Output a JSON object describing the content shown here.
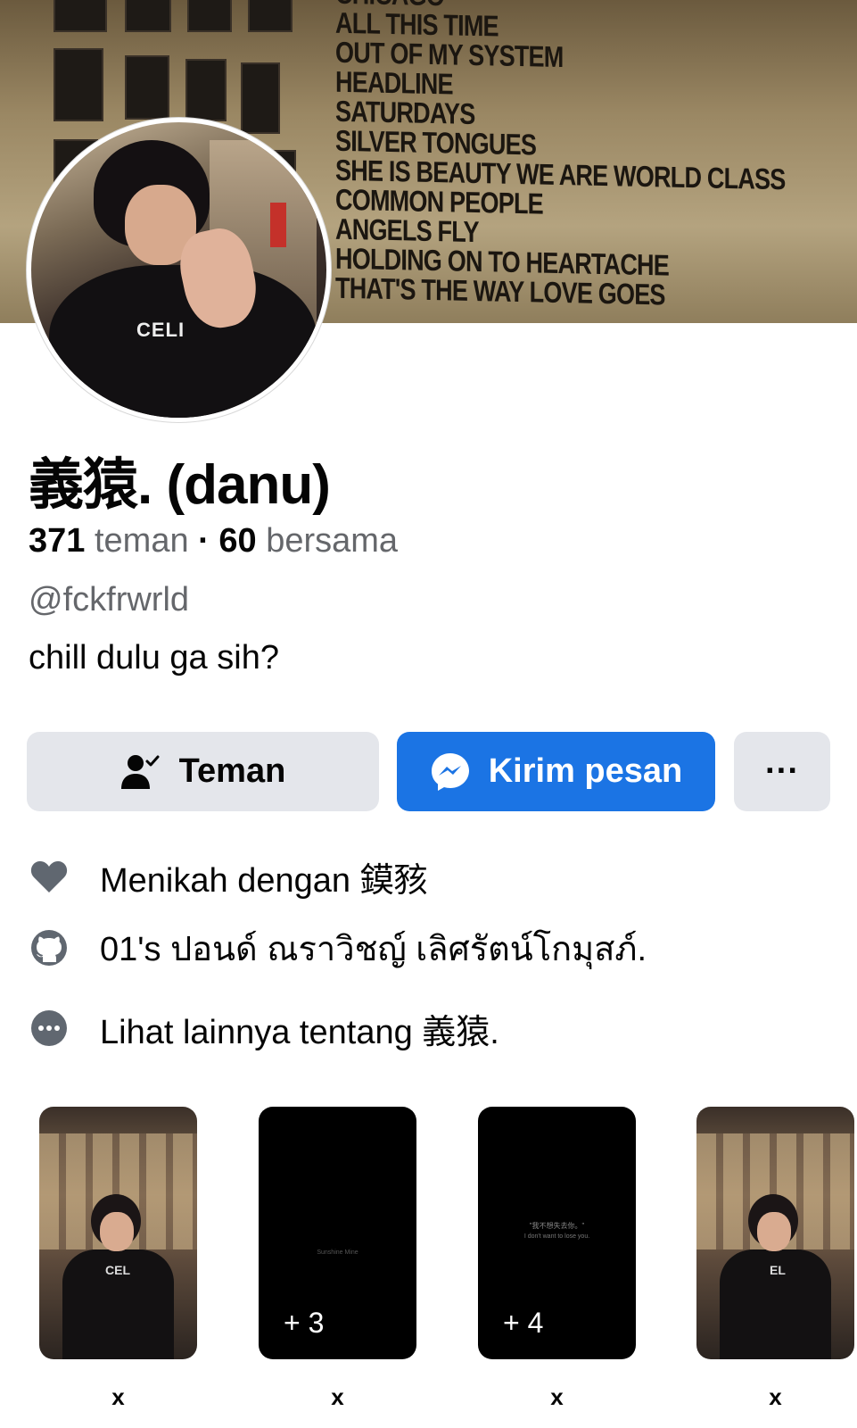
{
  "cover": {
    "wall_lines": [
      "CHICAGO",
      "ALL THIS TIME",
      "OUT OF MY SYSTEM",
      "HEADLINE",
      "SATURDAYS",
      "SILVER TONGUES",
      "SHE IS BEAUTY WE ARE WORLD CLASS",
      "COMMON PEOPLE",
      "ANGELS FLY",
      "HOLDING ON TO HEARTACHE",
      "THAT'S THE WAY LOVE GOES"
    ]
  },
  "avatar": {
    "shirt_text": "CELI"
  },
  "profile": {
    "name": "義猿. (danu)",
    "friends_count": "371",
    "friends_label": "teman",
    "separator": "·",
    "mutual_count": "60",
    "mutual_label": "bersama",
    "username": "@fckfrwrld",
    "bio": "chill dulu ga sih?"
  },
  "actions": {
    "friend_label": "Teman",
    "message_label": "Kirim pesan",
    "more_label": "···"
  },
  "details": [
    {
      "icon": "heart-icon",
      "text": "Menikah dengan 鏌豥"
    },
    {
      "icon": "github-icon",
      "text": "01's ปอนด์ ณราวิชญ์ เลิศรัตน์โกมุสภ์."
    },
    {
      "icon": "more-dots-icon",
      "text": "Lihat lainnya tentang 義猿."
    }
  ],
  "featured": [
    {
      "type": "photo",
      "label": "x",
      "shirt_text": "CEL"
    },
    {
      "type": "dark",
      "label": "x",
      "count": "+ 3",
      "small_text": "Sunshine\nMine"
    },
    {
      "type": "dark",
      "label": "x",
      "count": "+ 4",
      "small_text": "\"我不想失去你。\"",
      "small_text_2": "I don't want to lose you."
    },
    {
      "type": "photo",
      "label": "x",
      "shirt_text": "EL"
    }
  ],
  "colors": {
    "accent": "#1b74e4",
    "button_grey": "#e4e6eb",
    "secondary_text": "#65676b",
    "icon_grey": "#606770"
  }
}
